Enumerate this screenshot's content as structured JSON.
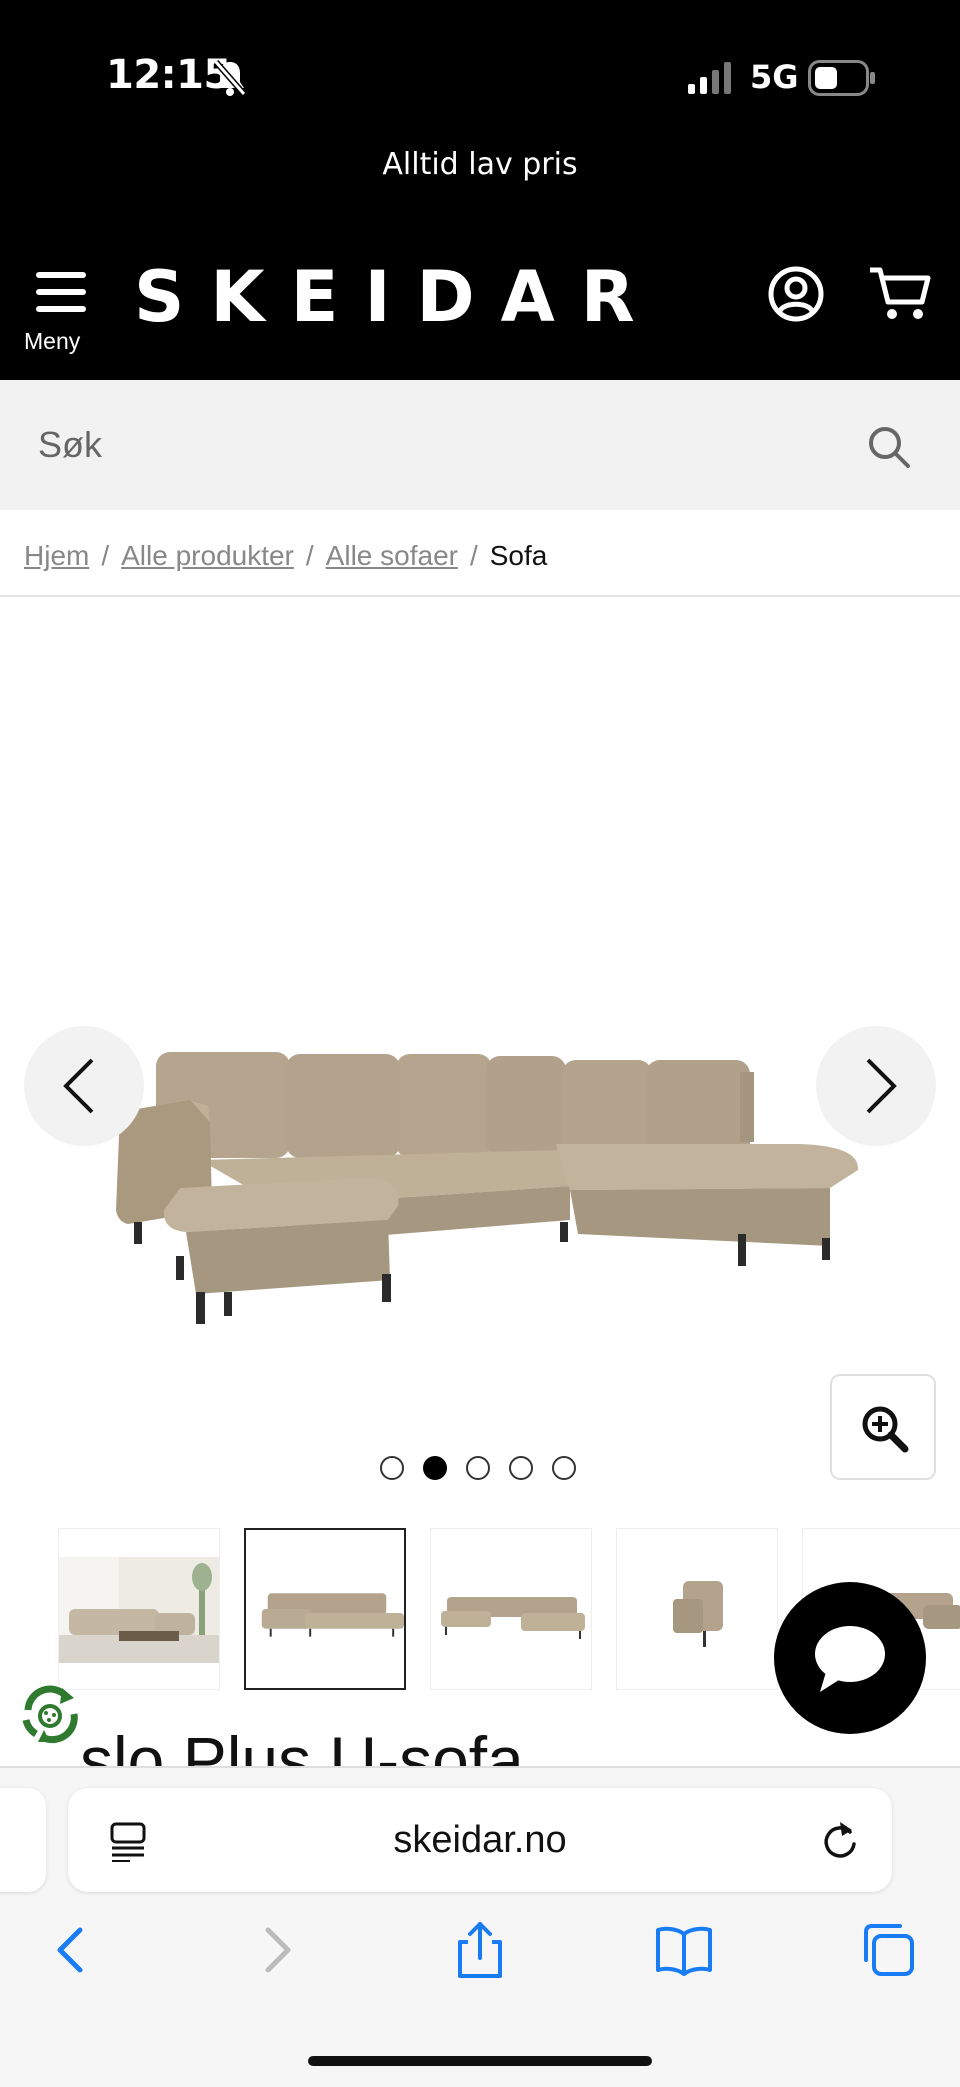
{
  "status_bar": {
    "time": "12:15",
    "network": "5G"
  },
  "header": {
    "promo": "Alltid lav pris",
    "menu_label": "Meny",
    "brand": "SKEIDAR"
  },
  "search": {
    "placeholder": "Søk"
  },
  "breadcrumb": {
    "items": [
      "Hjem",
      "Alle produkter",
      "Alle sofaer"
    ],
    "current": "Sofa"
  },
  "gallery": {
    "image_count": 5,
    "active_index": 1,
    "thumbnails": [
      "room-scene",
      "sofa-front",
      "sofa-wide",
      "sofa-side",
      "sofa-angle"
    ]
  },
  "product": {
    "title": "slo Plus U-sofa"
  },
  "browser": {
    "url": "skeidar.no"
  },
  "colors": {
    "header_bg": "#000000",
    "sofa_fabric": "#b3a48d",
    "recycle_green": "#2f7a2f"
  }
}
